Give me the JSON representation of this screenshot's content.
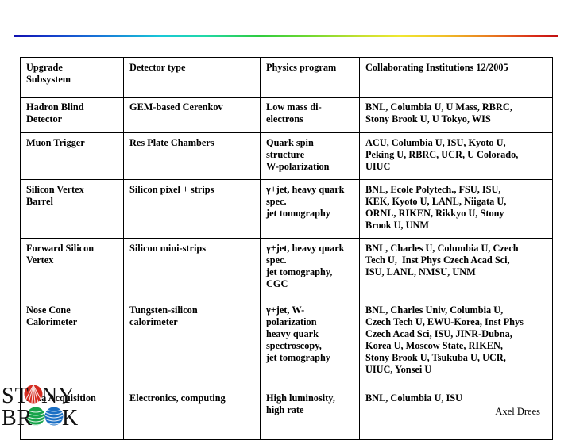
{
  "slide": {
    "background_color": "#ffffff",
    "rule_gradient": [
      "#1010b0",
      "#18c8d8",
      "#2ecc40",
      "#f0e830",
      "#e87820",
      "#c01010"
    ]
  },
  "table": {
    "headers": [
      "Upgrade\nSubsystem",
      "Detector type",
      "Physics program",
      "Collaborating Institutions 12/2005"
    ],
    "rows": [
      {
        "subsystem": "Hadron Blind\nDetector",
        "detector_type": "GEM-based Cerenkov",
        "physics_program": "Low mass di-\nelectrons",
        "institutions": "BNL, Columbia U, U Mass, RBRC,\nStony Brook U, U Tokyo, WIS"
      },
      {
        "subsystem": "Muon Trigger",
        "detector_type": "Res Plate Chambers",
        "physics_program": "Quark spin\nstructure\nW-polarization",
        "institutions": "ACU, Columbia U, ISU, Kyoto U,\nPeking U, RBRC, UCR, U Colorado,\nUIUC"
      },
      {
        "subsystem": "Silicon Vertex\nBarrel",
        "detector_type": "Silicon pixel + strips",
        "physics_program": "γ+jet, heavy quark\nspec.\njet tomography",
        "institutions": "BNL, Ecole Polytech., FSU, ISU,\nKEK, Kyoto U, LANL, Niigata U,\nORNL, RIKEN, Rikkyo U, Stony\nBrook U, UNM"
      },
      {
        "subsystem": "Forward Silicon\nVertex",
        "detector_type": "Silicon mini-strips",
        "physics_program": "γ+jet, heavy quark\nspec.\njet tomography,\nCGC",
        "institutions": "BNL, Charles U, Columbia U, Czech\nTech U,  Inst Phys Czech Acad Sci,\nISU, LANL, NMSU, UNM"
      },
      {
        "subsystem": "Nose Cone\nCalorimeter",
        "detector_type": "Tungsten-silicon\ncalorimeter",
        "physics_program": "γ+jet, W-\npolarization\nheavy quark\nspectroscopy,\njet tomography",
        "institutions": "BNL, Charles Univ, Columbia U,\nCzech Tech U, EWU-Korea, Inst Phys\nCzech Acad Sci, ISU, JINR-Dubna,\nKorea U, Moscow State, RIKEN,\nStony Brook U, Tsukuba U, UCR,\nUIUC, Yonsei U"
      },
      {
        "subsystem": "Data Acquisition",
        "detector_type": "Electronics, computing",
        "physics_program": "High luminosity,\nhigh rate",
        "institutions": "BNL, Columbia U, ISU"
      }
    ]
  },
  "logo": {
    "line1": "STONY",
    "line2": "BROOK",
    "colors": {
      "red": "#d42b20",
      "green": "#17a44a",
      "blue": "#1b6fc4"
    }
  },
  "footer": {
    "author": "Axel Drees"
  }
}
